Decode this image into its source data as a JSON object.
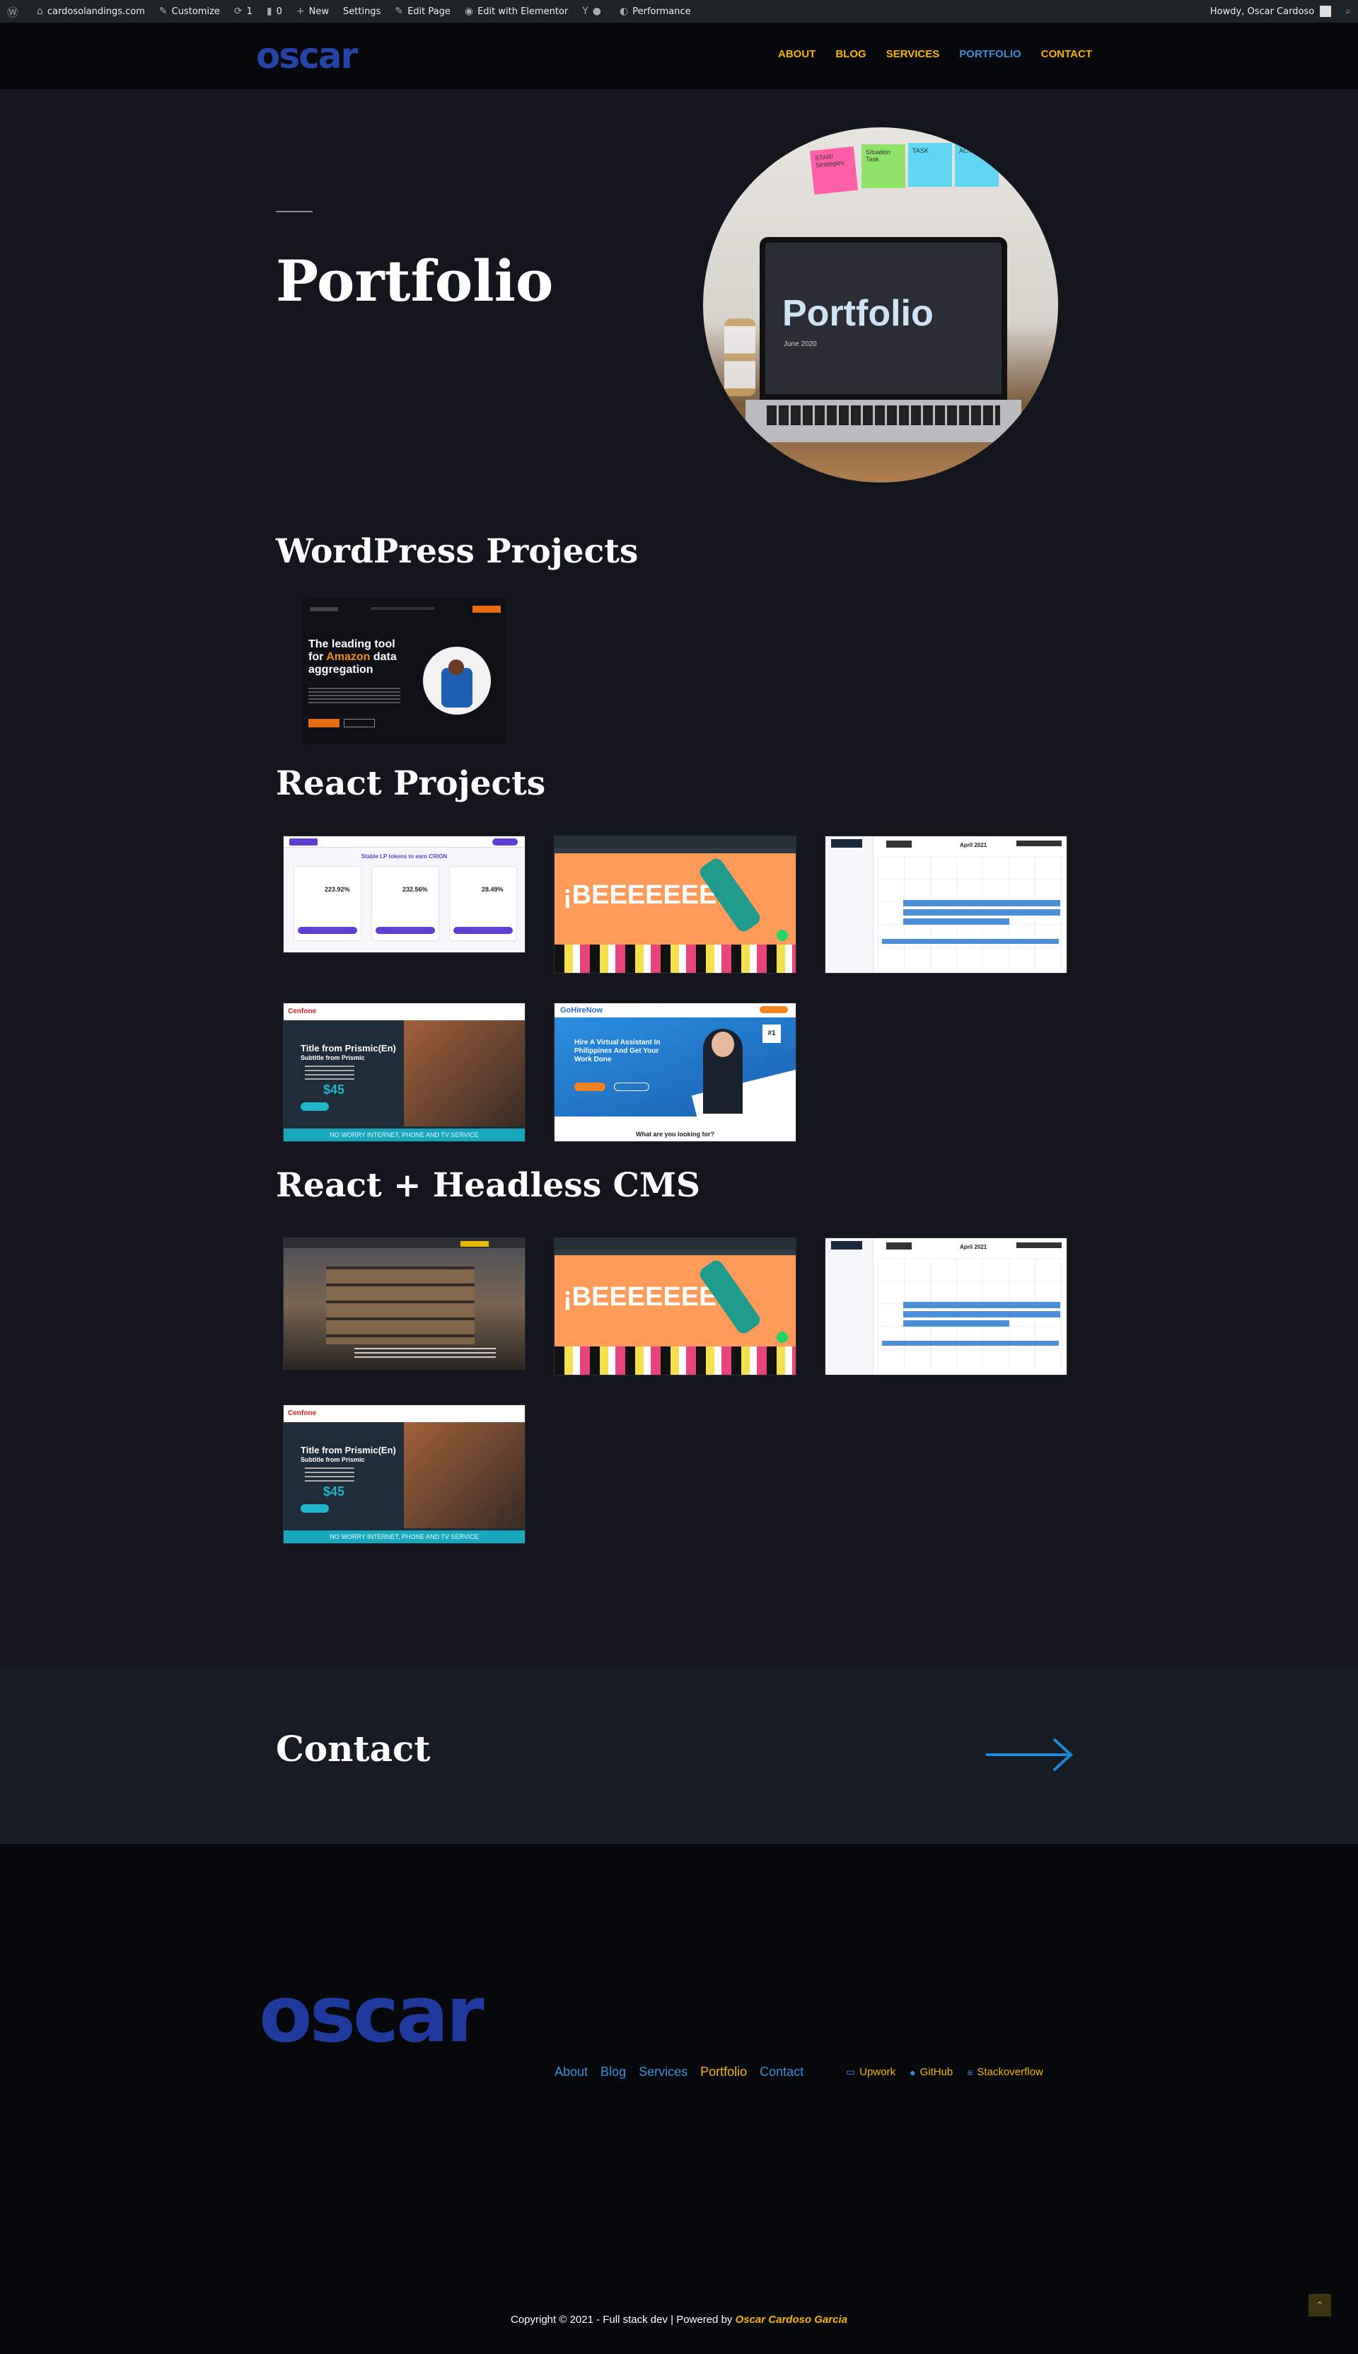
{
  "adminbar": {
    "site": "cardosolandings.com",
    "customize": "Customize",
    "updates": "1",
    "comments": "0",
    "new": "New",
    "settings": "Settings",
    "edit_page": "Edit Page",
    "elementor": "Edit with Elementor",
    "performance": "Performance",
    "howdy": "Howdy, Oscar Cardoso"
  },
  "header": {
    "logo": "oscar",
    "nav": [
      "ABOUT",
      "BLOG",
      "SERVICES",
      "PORTFOLIO",
      "CONTACT"
    ],
    "active": "PORTFOLIO"
  },
  "hero": {
    "title": "Portfolio",
    "image_word": "Portfolio",
    "image_date": "June 2020",
    "notes": [
      "STAR! Strategies",
      "Situation Task",
      "TASK",
      "ACTION"
    ]
  },
  "sections": {
    "wordpress": "WordPress Projects",
    "react": "React Projects",
    "headless": "React + Headless CMS"
  },
  "thumbs": {
    "wp1": {
      "headline_a": "The leading tool",
      "headline_b": "for ",
      "headline_c": "Amazon",
      "headline_d": " data",
      "headline_e": "aggregation"
    },
    "socks": {
      "headline": "¡BEEEEEEE!"
    },
    "calendar": {
      "month": "April 2021"
    },
    "cenfone": {
      "brand": "Cenfone",
      "title": "Title from Prismic(En)",
      "sub": "Subtitle from Prismic",
      "price": "$45",
      "banner": "NO WORRY INTERNET, PHONE AND TV SERVICE"
    },
    "gohire": {
      "brand": "GoHireNow",
      "headline": "Hire A Virtual Assistant In Philippines And Get Your Work Done",
      "question": "What are you looking for?",
      "badge": "#1"
    },
    "crypto": {
      "title": "Stable LP tokens to earn CRION",
      "stats": [
        "223.92%",
        "232.56%",
        "28.49%"
      ]
    }
  },
  "contact": {
    "title": "Contact"
  },
  "footer": {
    "logo": "oscar",
    "nav": [
      "About",
      "Blog",
      "Services",
      "Portfolio",
      "Contact"
    ],
    "active": "Portfolio",
    "social": [
      "Upwork",
      "GitHub",
      "Stackoverflow"
    ],
    "copyright_pre": "Copyright © 2021 - Full stack dev | Powered by ",
    "copyright_brand": "Oscar Cardoso Garcia"
  },
  "colors": {
    "accent": "#f5b400",
    "link": "#3c8ed8",
    "logo": "#2643a8",
    "bg": "#13161d"
  }
}
